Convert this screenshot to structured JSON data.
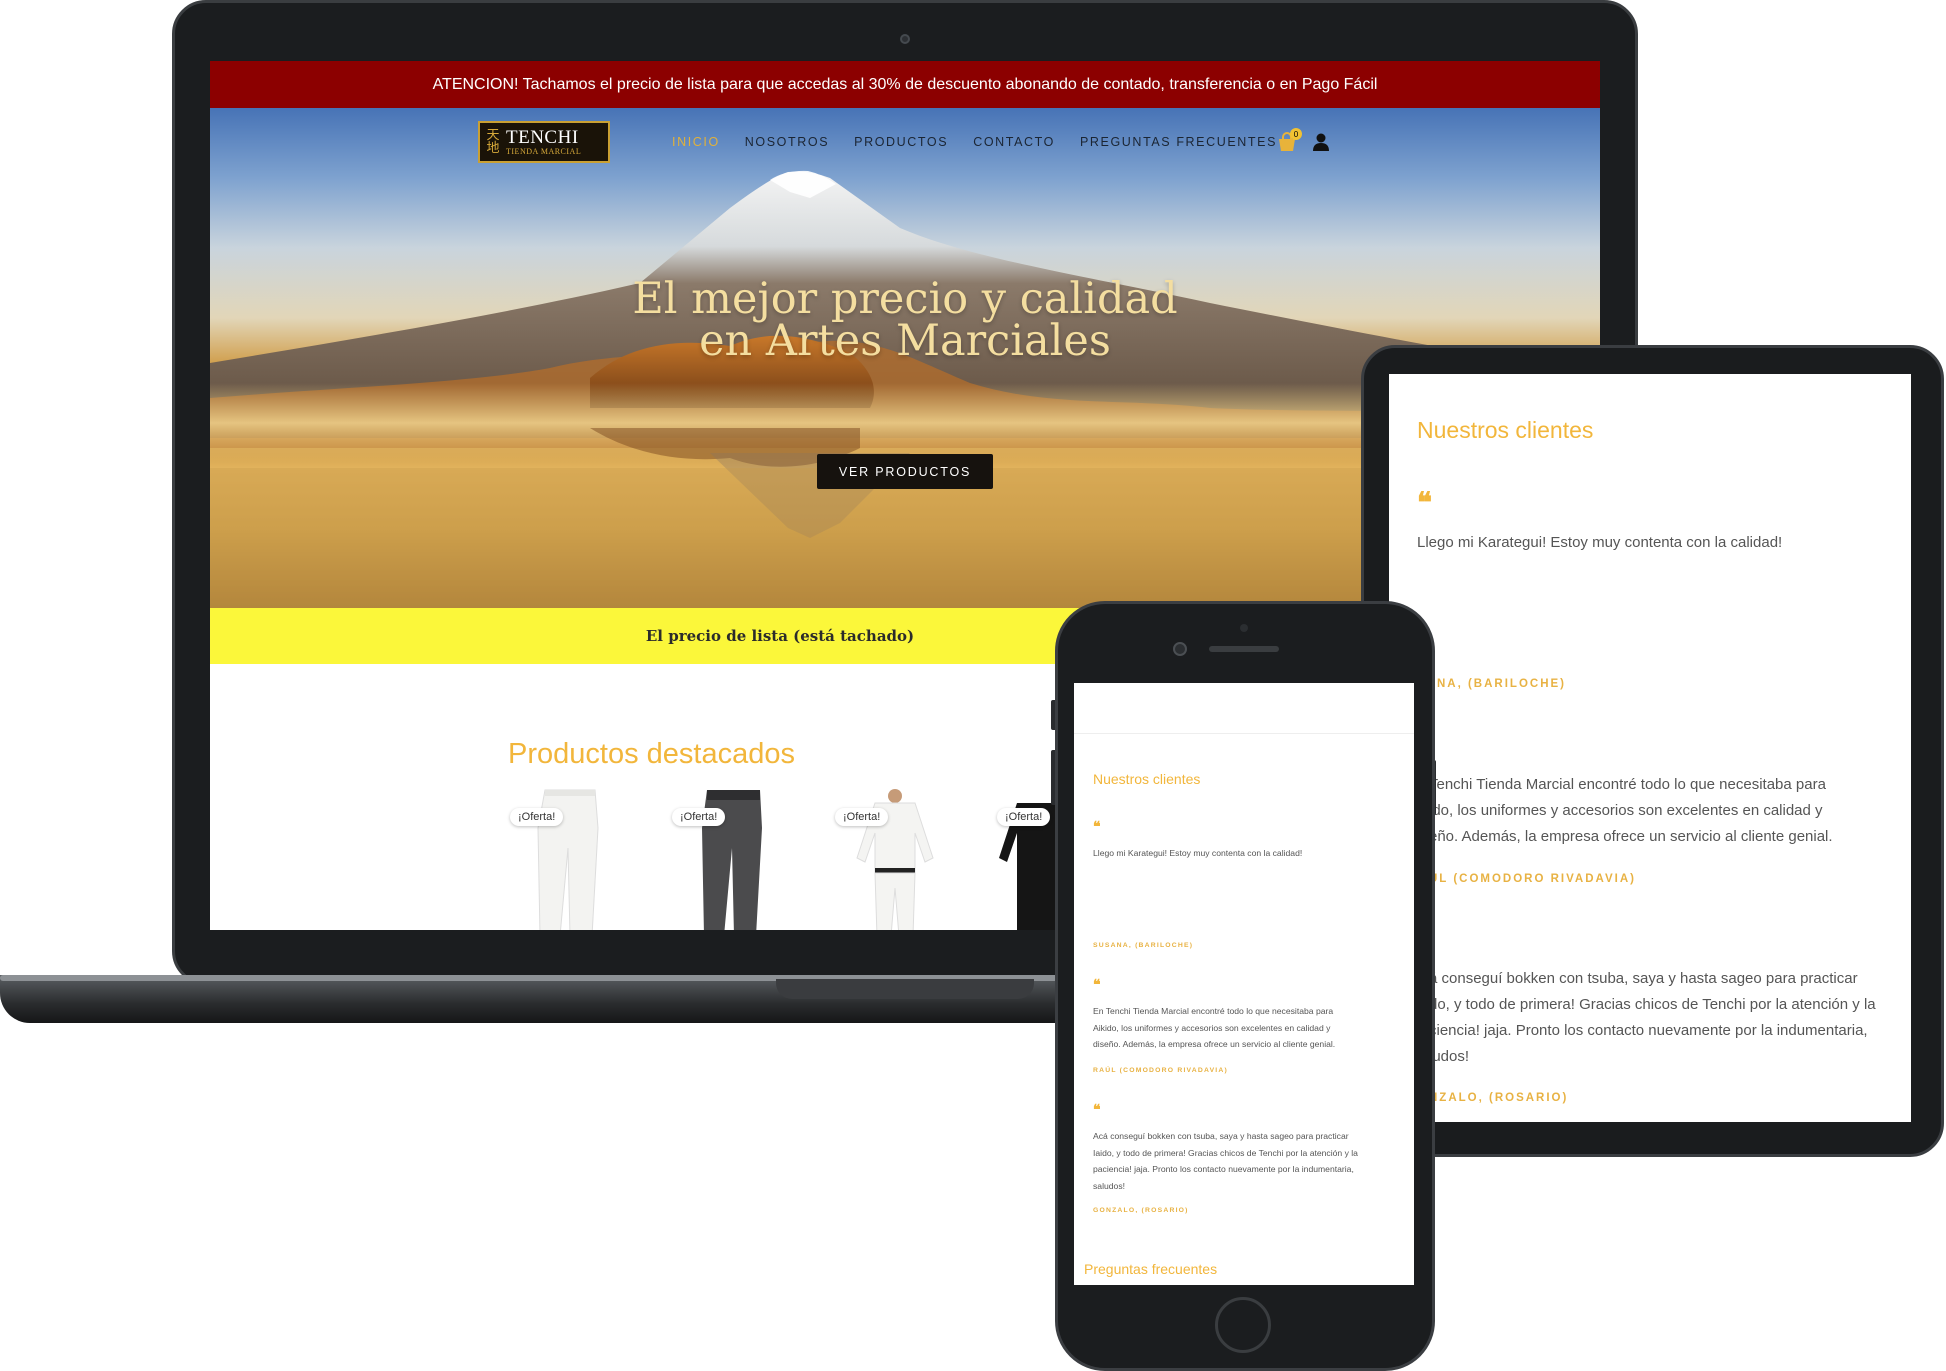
{
  "laptop": {
    "announcement": "ATENCION! Tachamos el precio de lista para que accedas al 30% de descuento abonando de contado, transferencia o en Pago Fácil",
    "logo": {
      "kanji_top": "天",
      "kanji_bottom": "地",
      "name": "TENCHI",
      "subtitle": "TIENDA MARCIAL"
    },
    "nav": [
      "INICIO",
      "NOSOTROS",
      "PRODUCTOS",
      "CONTACTO",
      "PREGUNTAS FRECUENTES"
    ],
    "active_nav": "INICIO",
    "cart_count": "0",
    "hero_title_line1": "El mejor precio y calidad",
    "hero_title_line2": "en Artes Marciales",
    "hero_button": "VER PRODUCTOS",
    "notice": "El precio de lista (está tachado)",
    "products_title": "Productos destacados",
    "product_badges": [
      "¡Oferta!",
      "¡Oferta!",
      "¡Oferta!",
      "¡Oferta!"
    ]
  },
  "tablet": {
    "title": "Nuestros clientes",
    "testimonials": [
      {
        "text": "Llego mi Karategui! Estoy muy contenta con la calidad!",
        "author": "SANA, (BARILOCHE)"
      },
      {
        "line1": "Tenchi Tienda Marcial encontré todo lo que necesitaba para",
        "line2": "ido, los uniformes y accesorios son excelentes en calidad y",
        "line3": "eño. Además, la empresa ofrece un servicio al cliente genial.",
        "author": "ÚL (COMODORO RIVADAVIA)"
      },
      {
        "line1": "á conseguí bokken con tsuba, saya y hasta sageo para practicar",
        "line2": "do, y todo de primera! Gracias chicos de Tenchi por la atención y la",
        "line3": "ciencia! jaja. Pronto los contacto nuevamente por la indumentaria,",
        "line4": "ludos!",
        "author": "NZALO, (ROSARIO)"
      }
    ]
  },
  "phone": {
    "title": "Nuestros clientes",
    "testimonials": [
      {
        "text": "Llego mi Karategui! Estoy muy contenta con la calidad!",
        "author": "SUSANA, (BARILOCHE)"
      },
      {
        "line1": "En Tenchi Tienda Marcial encontré todo lo que necesitaba para",
        "line2": "Aikido, los uniformes y accesorios son excelentes en calidad y",
        "line3": "diseño. Además, la empresa ofrece un servicio al cliente genial.",
        "author": "RAÚL (COMODORO RIVADAVIA)"
      },
      {
        "line1": "Acá conseguí bokken con tsuba, saya y hasta sageo para practicar",
        "line2": "Iaido, y todo de primera! Gracias chicos de Tenchi por la atención y la",
        "line3": "paciencia! jaja. Pronto los contacto nuevamente por la indumentaria,",
        "line4": "saludos!",
        "author": "GONZALO, (ROSARIO)"
      }
    ],
    "faq_title": "Preguntas frecuentes"
  },
  "colors": {
    "accent": "#f2b63b",
    "announcement_bg": "#8c0000",
    "notice_bg": "#fbf73a",
    "dark": "#16120e"
  },
  "icons": {
    "cart": "shopping-bag-icon",
    "user": "user-icon",
    "quote": "quote-icon"
  }
}
